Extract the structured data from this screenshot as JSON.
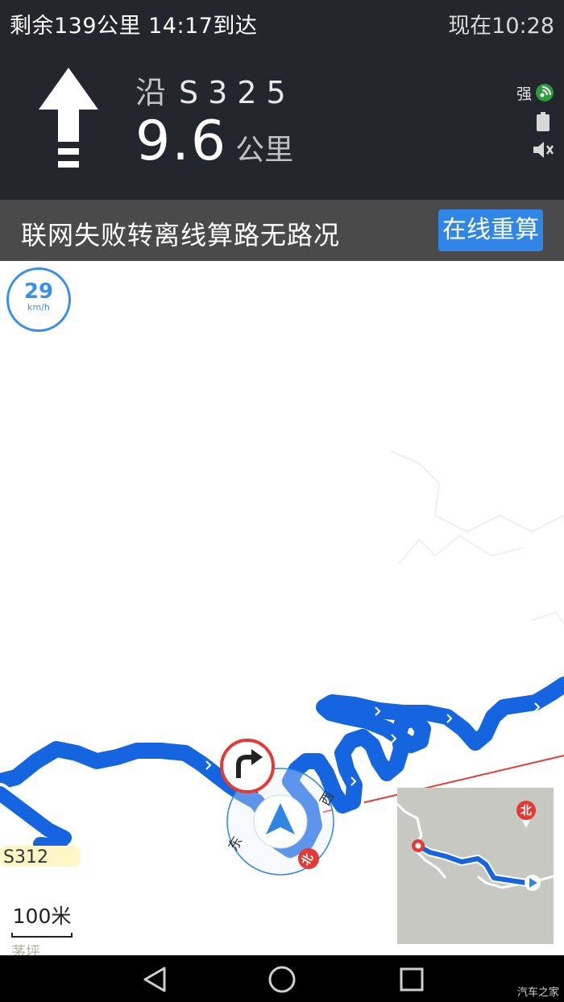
{
  "status_bar": {
    "remaining": "剩余139公里 14:17到达",
    "now": "现在10:28"
  },
  "nav": {
    "road_prefix": "沿",
    "road_name": "S325",
    "distance": "9.6",
    "distance_unit": "公里",
    "gps_signal": "强",
    "turn_icon": "straight-arrow-icon"
  },
  "banner": {
    "message": "联网失败转离线算路无路况",
    "button_label": "在线重算"
  },
  "map": {
    "speed_value": "29",
    "speed_unit": "km/h",
    "scale_label": "100米",
    "road_label": "S312",
    "compass": {
      "east": "东",
      "south": "南",
      "west": "西",
      "north": "北"
    },
    "place_name": "茅坪",
    "route_color": "#1565e0",
    "minimap_north": "北"
  },
  "watermark": "汽车之家"
}
